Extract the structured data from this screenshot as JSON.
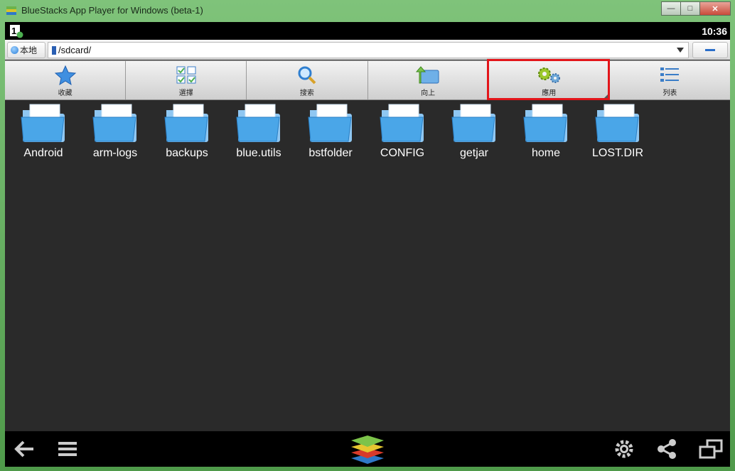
{
  "window": {
    "title": "BlueStacks App Player for Windows (beta-1)",
    "controls": {
      "minimize": "—",
      "maximize": "□",
      "close": "✕"
    }
  },
  "status": {
    "time": "10:36",
    "notify_badge": "1"
  },
  "pathbar": {
    "local_label": "本地",
    "path": "/sdcard/"
  },
  "toolbar": {
    "items": [
      {
        "label": "收藏",
        "icon": "star-icon"
      },
      {
        "label": "選擇",
        "icon": "checklist-icon"
      },
      {
        "label": "搜索",
        "icon": "magnifier-icon"
      },
      {
        "label": "向上",
        "icon": "up-folder-icon"
      },
      {
        "label": "應用",
        "icon": "gears-icon"
      },
      {
        "label": "列表",
        "icon": "list-icon"
      }
    ]
  },
  "files": [
    {
      "name": "Android"
    },
    {
      "name": "arm-logs"
    },
    {
      "name": "backups"
    },
    {
      "name": "blue.utils"
    },
    {
      "name": "bstfolder"
    },
    {
      "name": "CONFIG"
    },
    {
      "name": "getjar"
    },
    {
      "name": "home"
    },
    {
      "name": "LOST.DIR"
    }
  ],
  "colors": {
    "highlight": "#e3151a",
    "folder": "#4aa6e8",
    "screen_bg": "#2a2a2a"
  }
}
